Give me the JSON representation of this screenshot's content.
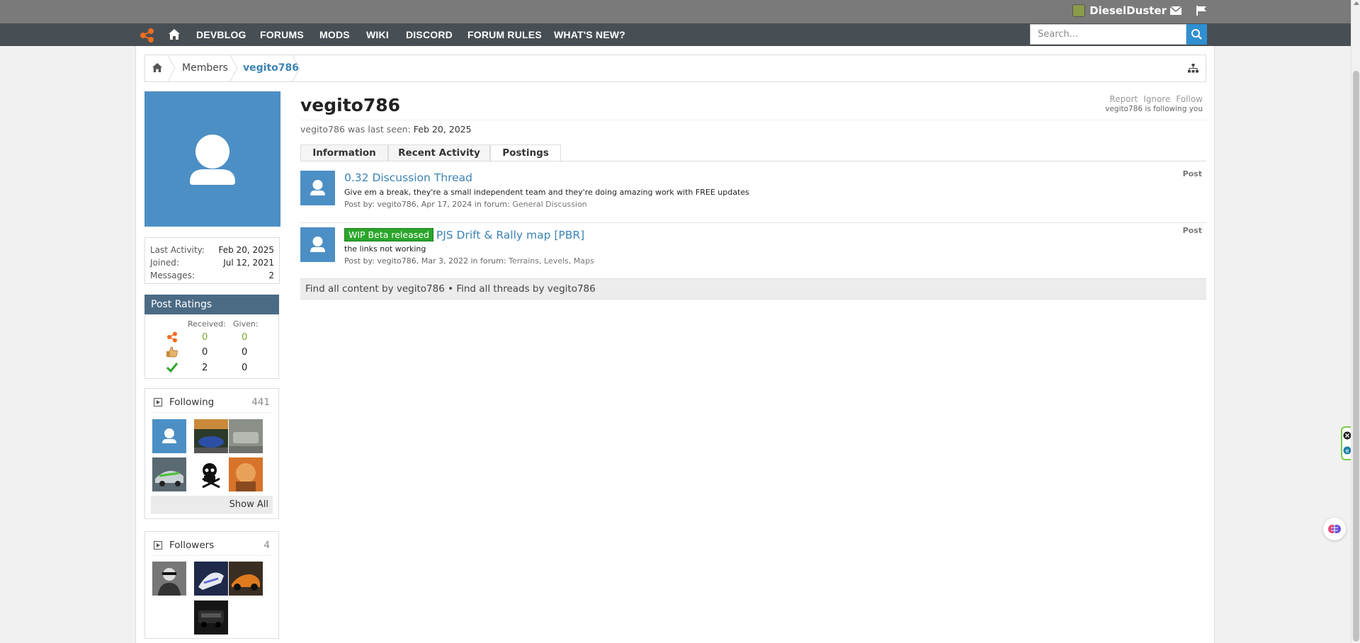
{
  "topbar": {
    "username": "DieselDuster"
  },
  "nav": {
    "items": [
      "DEVBLOG",
      "FORUMS",
      "MODS",
      "WIKI",
      "DISCORD",
      "FORUM RULES",
      "WHAT'S NEW?"
    ],
    "search_placeholder": "Search..."
  },
  "breadcrumb": {
    "members": "Members",
    "current": "vegito786"
  },
  "profile": {
    "name": "vegito786",
    "actions": [
      "Report",
      "Ignore",
      "Follow"
    ],
    "following_note": "vegito786 is following you",
    "last_seen_label": "vegito786 was last seen:",
    "last_seen_value": "Feb 20, 2025"
  },
  "stats": [
    {
      "label": "Last Activity:",
      "value": "Feb 20, 2025"
    },
    {
      "label": "Joined:",
      "value": "Jul 12, 2021"
    },
    {
      "label": "Messages:",
      "value": "2"
    }
  ],
  "ratings": {
    "title": "Post Ratings",
    "received_label": "Received:",
    "given_label": "Given:",
    "rows": [
      {
        "icon": "bmg-logo-icon",
        "received": "0",
        "given": "0",
        "color": "#7aa52c"
      },
      {
        "icon": "thumbs-up-icon",
        "received": "0",
        "given": "0",
        "color": "#333333"
      },
      {
        "icon": "checkmark-icon",
        "received": "2",
        "given": "0",
        "color": "#333333"
      }
    ]
  },
  "following": {
    "title": "Following",
    "count": "441",
    "show_all": "Show All"
  },
  "followers": {
    "title": "Followers",
    "count": "4"
  },
  "tabs": [
    "Information",
    "Recent Activity",
    "Postings"
  ],
  "posts": [
    {
      "badge": "",
      "title": "0.32 Discussion Thread",
      "snippet": "Give em a break, they're a small independent team and they're doing amazing work with FREE updates",
      "meta_prefix": "Post by: vegito786, Apr 17, 2024 in forum:",
      "forum": "General Discussion",
      "type": "Post"
    },
    {
      "badge": "WIP Beta released",
      "title": "PJS Drift & Rally map [PBR]",
      "snippet": "the links not working",
      "meta_prefix": "Post by: vegito786, Mar 3, 2022 in forum:",
      "forum": "Terrains, Levels, Maps",
      "type": "Post"
    }
  ],
  "find_all": {
    "content": "Find all content by vegito786",
    "sep": "•",
    "threads": "Find all threads by vegito786"
  },
  "colors": {
    "accent": "#3b83b5",
    "nav_bg": "#484f54",
    "avatar_bg": "#4c8fc5",
    "badge_green": "#2aa52a"
  }
}
